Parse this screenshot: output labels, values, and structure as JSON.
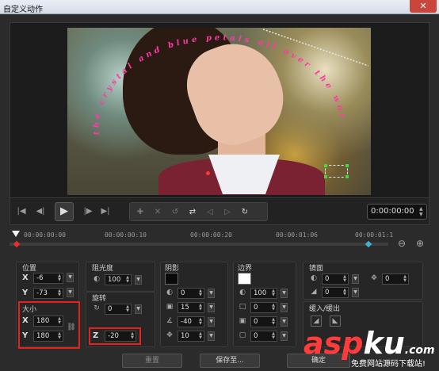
{
  "window": {
    "title": "自定义动作",
    "close_glyph": "✕"
  },
  "preview": {
    "overlay_text": "the crystal and blue petals all over the world"
  },
  "controls": {
    "time": "0:00:00:00"
  },
  "timeline": {
    "ticks": [
      "00:00:00:00",
      "00:00:00:10",
      "00:00:00:20",
      "00:00:01:06",
      "00:00:01:1"
    ]
  },
  "position": {
    "title": "位置",
    "x_label": "X",
    "x_value": "-6",
    "y_label": "Y",
    "y_value": "-73"
  },
  "size": {
    "title": "大小",
    "x_label": "X",
    "x_value": "180",
    "y_label": "Y",
    "y_value": "180"
  },
  "opacity": {
    "title": "阻光度",
    "value": "100"
  },
  "rotation": {
    "title": "旋转",
    "value": "0",
    "z_label": "Z",
    "z_value": "-20"
  },
  "shadow": {
    "title": "阴影",
    "v1": "0",
    "v2": "15",
    "v3": "-40",
    "v4": "10",
    "swatch_color": "#0a0a0a"
  },
  "border": {
    "title": "边界",
    "v1": "100",
    "v2": "0",
    "v3": "0",
    "v4": "0",
    "swatch_color": "#ffffff"
  },
  "mirror": {
    "title": "镜面",
    "v1": "0",
    "v2": "0",
    "v3": "0"
  },
  "fade": {
    "title": "缓入/缓出"
  },
  "buttons": {
    "reset": "重置",
    "save_to": "保存至...",
    "ok": "确定"
  },
  "watermark": {
    "brand_a": "asp",
    "brand_b": "ku",
    "brand_c": ".com",
    "subtitle": "免费网站源码下载站!",
    "color_a": "#ff3b3b",
    "color_b": "#ffffff"
  }
}
